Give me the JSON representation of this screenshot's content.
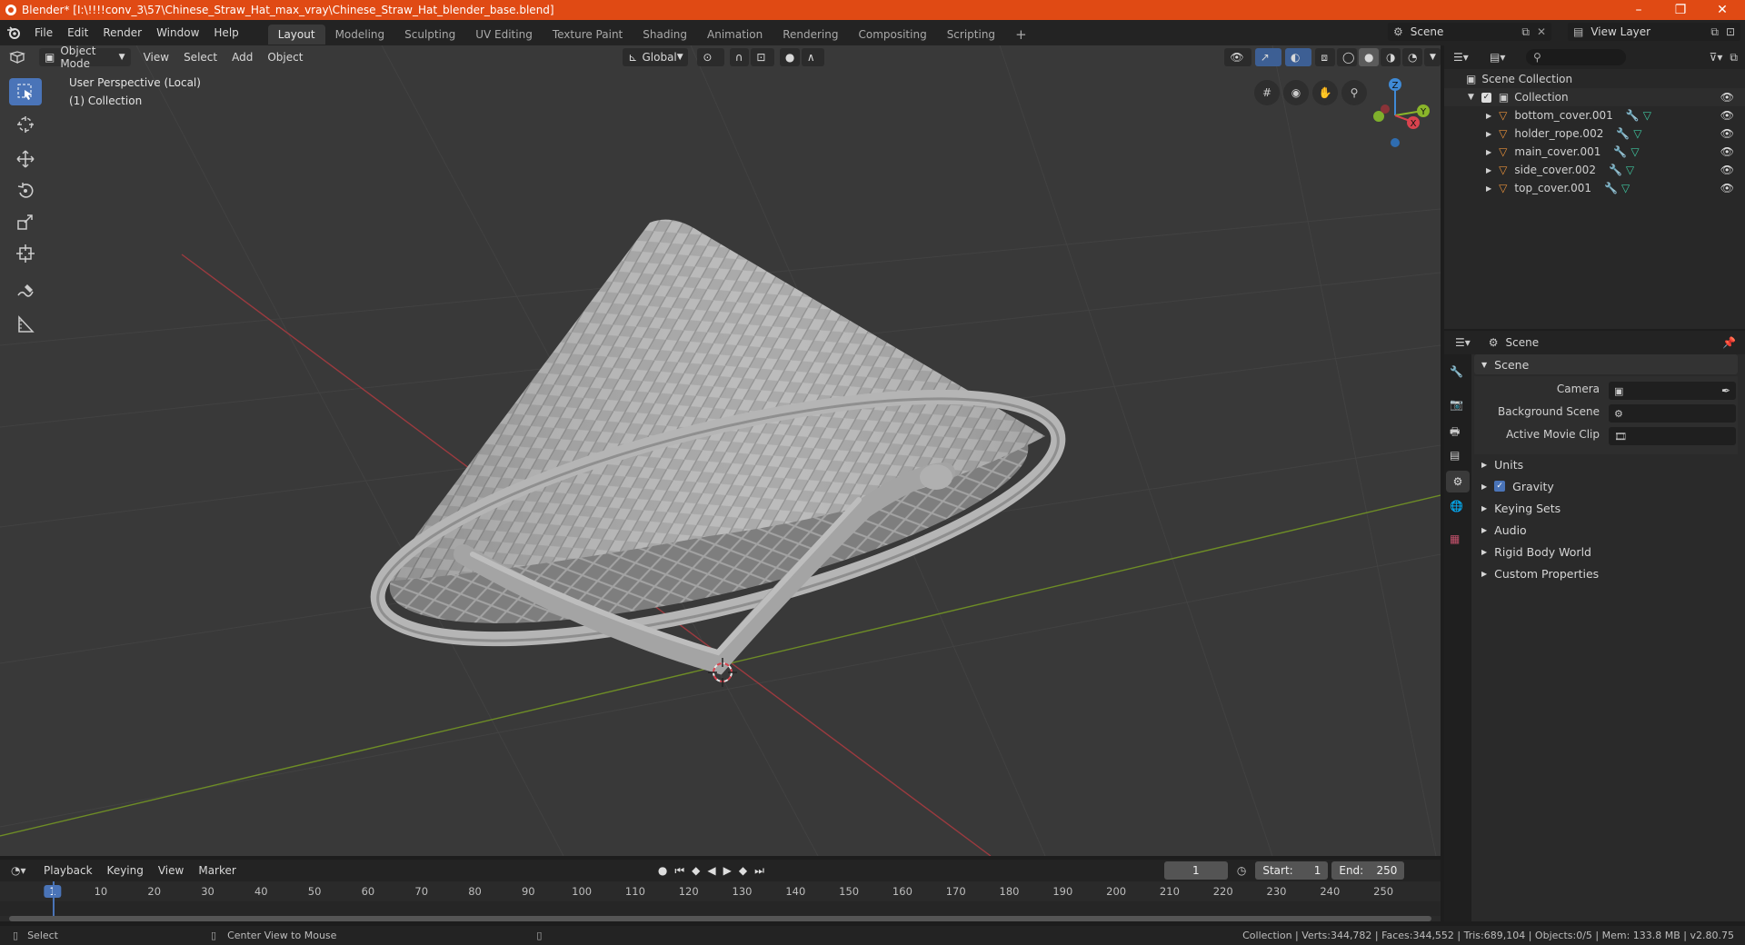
{
  "window": {
    "title": "Blender* [I:\\!!!!conv_3\\57\\Chinese_Straw_Hat_max_vray\\Chinese_Straw_Hat_blender_base.blend]",
    "minimize": "–",
    "maximize": "❐",
    "close": "✕"
  },
  "menu": {
    "items": [
      "File",
      "Edit",
      "Render",
      "Window",
      "Help"
    ]
  },
  "workspaces": [
    "Layout",
    "Modeling",
    "Sculpting",
    "UV Editing",
    "Texture Paint",
    "Shading",
    "Animation",
    "Rendering",
    "Compositing",
    "Scripting"
  ],
  "workspace_add": "+",
  "scene_selector": "Scene",
  "view_layer": "View Layer",
  "viewport": {
    "mode": "Object Mode",
    "menus": [
      "View",
      "Select",
      "Add",
      "Object"
    ],
    "transform_orientation": "Global",
    "overlay_line1": "User Perspective (Local)",
    "overlay_line2": "(1) Collection",
    "gizmo": {
      "z": "Z",
      "y": "Y",
      "x": "X"
    }
  },
  "outliner": {
    "search_placeholder": "",
    "root": "Scene Collection",
    "collection": "Collection",
    "objects": [
      "bottom_cover.001",
      "holder_rope.002",
      "main_cover.001",
      "side_cover.002",
      "top_cover.001"
    ]
  },
  "properties": {
    "context": "Scene",
    "panel_title": "Scene",
    "fields": [
      {
        "label": "Camera",
        "value": ""
      },
      {
        "label": "Background Scene",
        "value": ""
      },
      {
        "label": "Active Movie Clip",
        "value": ""
      }
    ],
    "sections": [
      "Units",
      "Gravity",
      "Keying Sets",
      "Audio",
      "Rigid Body World",
      "Custom Properties"
    ],
    "gravity_checked": true
  },
  "timeline": {
    "menus": [
      "Playback",
      "Keying",
      "View",
      "Marker"
    ],
    "current_frame": "1",
    "start_label": "Start:",
    "start": "1",
    "end_label": "End:",
    "end": "250",
    "ruler": [
      "1",
      "10",
      "20",
      "30",
      "40",
      "50",
      "60",
      "70",
      "80",
      "90",
      "100",
      "110",
      "120",
      "130",
      "140",
      "150",
      "160",
      "170",
      "180",
      "190",
      "200",
      "210",
      "220",
      "230",
      "240",
      "250"
    ]
  },
  "status": {
    "left_action": "Select",
    "middle_action": "Center View to Mouse",
    "stats": "Collection | Verts:344,782 | Faces:344,552 | Tris:689,104 | Objects:0/5 | Mem: 133.8 MB | v2.80.75"
  },
  "colors": {
    "titlebar": "#e04a14",
    "active_tool": "#4a74b8",
    "x_axis": "#d9434e",
    "y_axis": "#8ab52a",
    "z_axis": "#3f8ad6",
    "object_icon": "#e7913a"
  }
}
